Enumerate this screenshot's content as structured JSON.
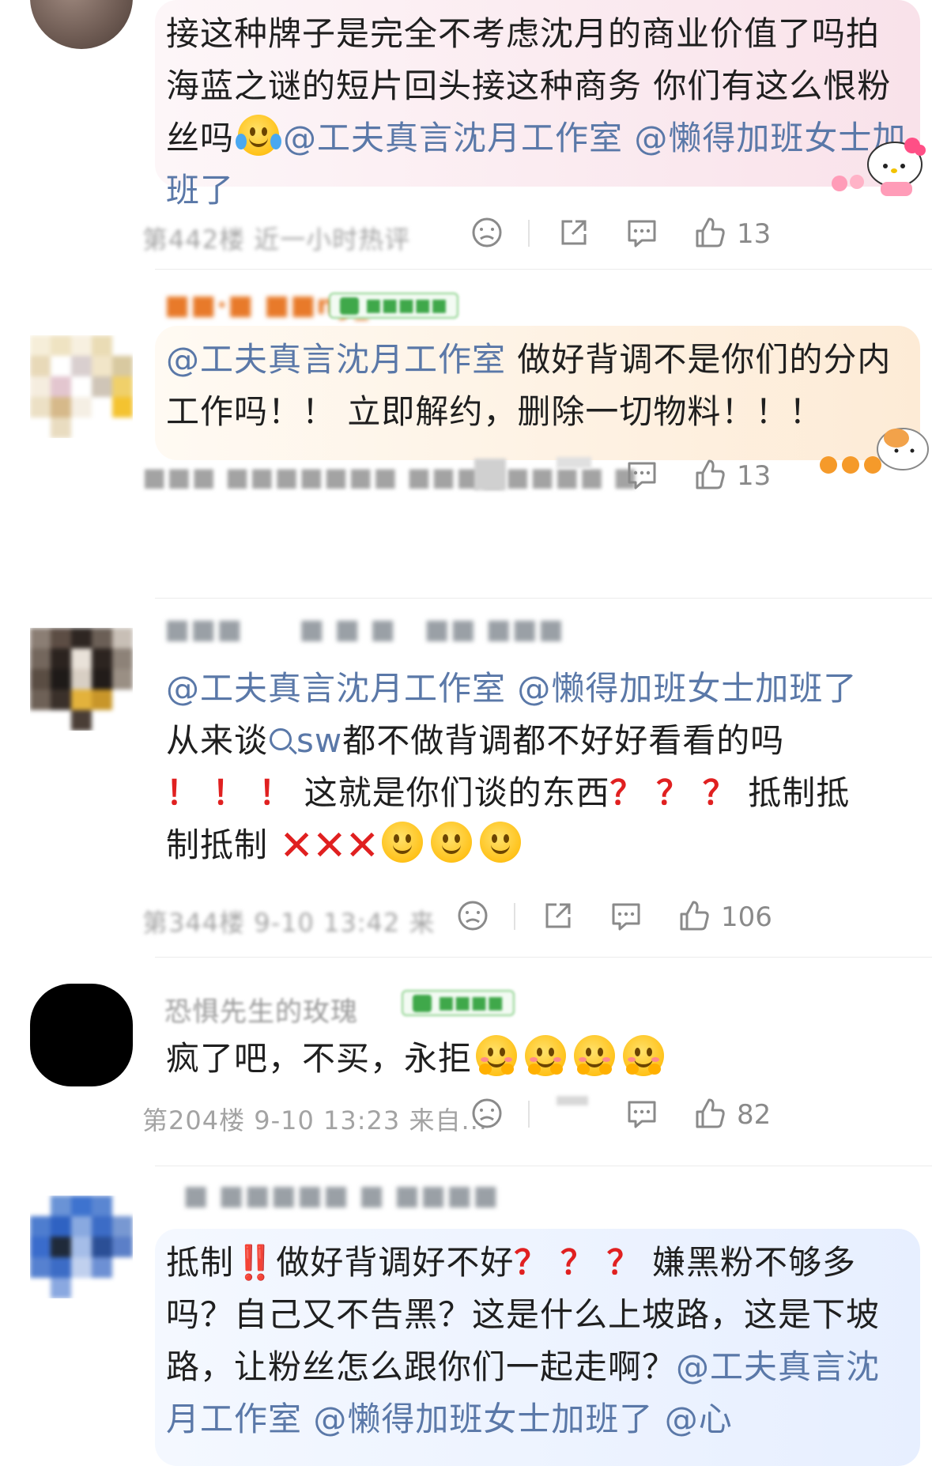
{
  "comments": [
    {
      "segments": [
        {
          "text": "接这种牌子是完全不考虑沈月的商业价值了吗拍海蓝之谜的短片回头接这种商务 你们有这么恨粉丝吗"
        },
        {
          "emoji": "laughing-tears"
        },
        {
          "mention": "@工夫真言沈月工作室"
        },
        {
          "text": " "
        },
        {
          "mention": "@懒得加班女士加班了"
        }
      ],
      "meta": "第442楼 近一小时热评",
      "likes": "13"
    },
    {
      "segments": [
        {
          "mention": "@工夫真言沈月工作室"
        },
        {
          "text": " 做好背调不是你们的分内工作吗！！ 立即解约，删除一切物料！！！"
        }
      ],
      "likes": "13"
    },
    {
      "line1_mention_a": "@工夫真言沈月工作室",
      "line1_mention_b": "@懒得加班女士加班了",
      "line2_prefix": "从来谈",
      "line2_search": "sw",
      "line2_suffix": "都不做背调都不好好看看的吗",
      "line3_exclaims": "！ ！ ！",
      "line3_mid": "这就是你们谈的东西",
      "line3_questions": "？ ？ ？",
      "line3_end": "抵制抵",
      "line4_start": "制抵制",
      "line4_crosses": "✕✕✕",
      "meta": "第344楼 9-10 13:42 来",
      "likes": "106"
    },
    {
      "username": "恐惧先生的玫瑰",
      "text": "疯了吧，不买，永拒",
      "meta": "第204楼 9-10 13:23 来自...",
      "likes": "82"
    },
    {
      "seg1": "抵制",
      "seg1_red": "‼️",
      "seg2": "做好背调好不好",
      "seg2_red": "？ ？ ？",
      "seg3": "嫌黑粉不够多吗？自己又不告黑？这是什么上坡路，这是下坡路，让粉丝怎么跟你们一起走啊？",
      "mention_a": "@工夫真言沈月工作室",
      "mention_b": "@懒得加班女士加班了",
      "mention_c": "@心"
    }
  ],
  "icons": {
    "dislike": "dislike-face-icon",
    "share": "share-icon",
    "reply": "comment-bubble-icon",
    "like": "thumbs-up-icon"
  },
  "colors": {
    "mention": "#5a78a8",
    "red": "#e02020",
    "meta": "#a3a3a3"
  }
}
